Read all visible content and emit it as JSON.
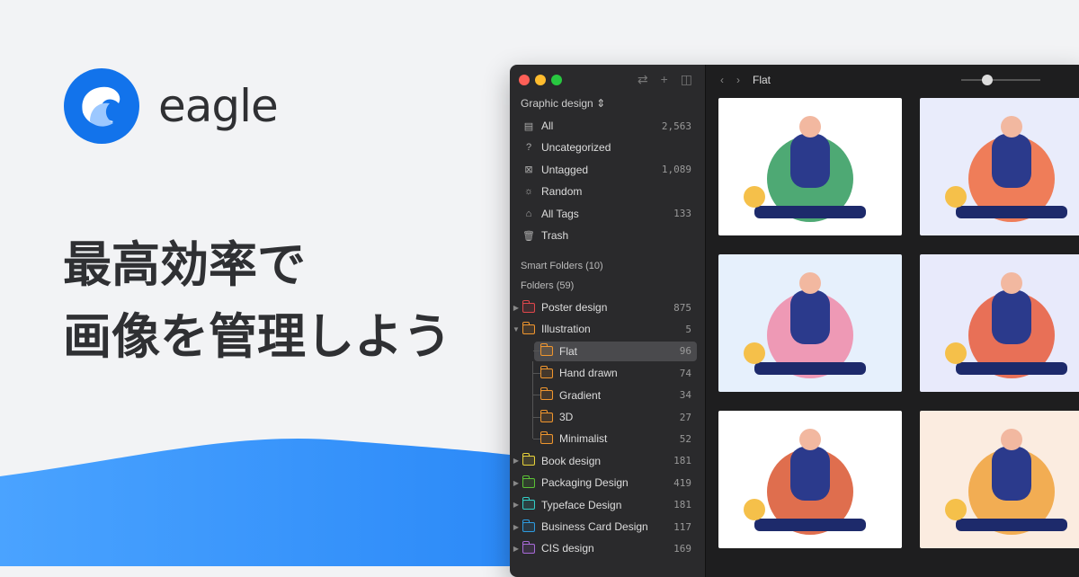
{
  "brand": {
    "name": "eagle",
    "color": "#1273eb"
  },
  "headline": {
    "line1": "最高効率で",
    "line2": "画像を管理しよう"
  },
  "sidebar": {
    "library_label": "Graphic design",
    "items": [
      {
        "label": "All",
        "count": "2,563",
        "icon": "archive-icon"
      },
      {
        "label": "Uncategorized",
        "count": "",
        "icon": "question-box-icon"
      },
      {
        "label": "Untagged",
        "count": "1,089",
        "icon": "untagged-icon"
      },
      {
        "label": "Random",
        "count": "",
        "icon": "lightbulb-icon"
      },
      {
        "label": "All Tags",
        "count": "133",
        "icon": "tag-icon"
      },
      {
        "label": "Trash",
        "count": "",
        "icon": "trash-icon"
      }
    ],
    "smart_folders": "Smart Folders (10)",
    "folders_title": "Folders (59)",
    "folders": [
      {
        "label": "Poster design",
        "count": "875",
        "color": "#e0474c",
        "expanded": false
      },
      {
        "label": "Illustration",
        "count": "5",
        "color": "#f0962e",
        "expanded": true,
        "children": [
          {
            "label": "Flat",
            "count": "96",
            "selected": true
          },
          {
            "label": "Hand drawn",
            "count": "74"
          },
          {
            "label": "Gradient",
            "count": "34"
          },
          {
            "label": "3D",
            "count": "27"
          },
          {
            "label": "Minimalist",
            "count": "52"
          }
        ]
      },
      {
        "label": "Book design",
        "count": "181",
        "color": "#e8d23a"
      },
      {
        "label": "Packaging Design",
        "count": "419",
        "color": "#5bc236"
      },
      {
        "label": "Typeface Design",
        "count": "181",
        "color": "#33d0c8"
      },
      {
        "label": "Business Card Design",
        "count": "117",
        "color": "#2e9be0"
      },
      {
        "label": "CIS design",
        "count": "169",
        "color": "#a86ad8"
      }
    ]
  },
  "main": {
    "title": "Flat",
    "zoom_slider": 0.33,
    "thumbnails": [
      {
        "bg": "#ffffff",
        "accent": "#2f9a5c"
      },
      {
        "bg": "#e9ecfb",
        "accent": "#f06a3c"
      },
      {
        "bg": "#e6f0fc",
        "accent": "#ef8aa8"
      },
      {
        "bg": "#e8eafb",
        "accent": "#e85a3a"
      },
      {
        "bg": "#ffffff",
        "accent": "#d9552f"
      },
      {
        "bg": "#fbece0",
        "accent": "#f0a23a"
      }
    ]
  }
}
